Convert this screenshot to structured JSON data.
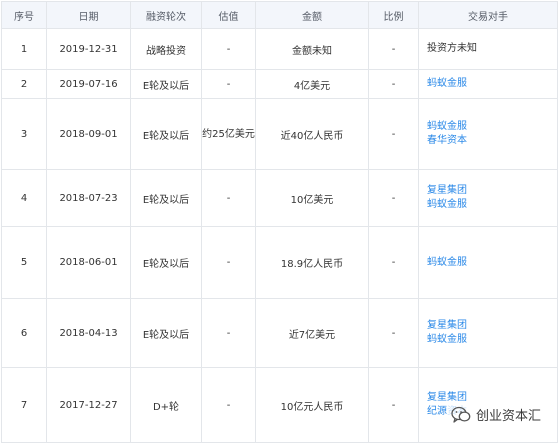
{
  "table": {
    "headers": [
      "序号",
      "日期",
      "融资轮次",
      "估值",
      "金额",
      "比例",
      "交易对手"
    ],
    "rows": [
      {
        "no": "1",
        "date": "2019-12-31",
        "round": "战略投资",
        "valuation": "-",
        "amount": "金额未知",
        "ratio": "-",
        "partners": [
          "投资方未知"
        ],
        "partners_linked": false
      },
      {
        "no": "2",
        "date": "2019-07-16",
        "round": "E轮及以后",
        "valuation": "-",
        "amount": "4亿美元",
        "ratio": "-",
        "partners": [
          "蚂蚁金服"
        ],
        "partners_linked": true
      },
      {
        "no": "3",
        "date": "2018-09-01",
        "round": "E轮及以后",
        "valuation": "约25亿美元",
        "amount": "近40亿人民币",
        "ratio": "-",
        "partners": [
          "蚂蚁金服",
          "春华资本"
        ],
        "partners_linked": true
      },
      {
        "no": "4",
        "date": "2018-07-23",
        "round": "E轮及以后",
        "valuation": "-",
        "amount": "10亿美元",
        "ratio": "-",
        "partners": [
          "复星集团",
          "蚂蚁金服"
        ],
        "partners_linked": true
      },
      {
        "no": "5",
        "date": "2018-06-01",
        "round": "E轮及以后",
        "valuation": "-",
        "amount": "18.9亿人民币",
        "ratio": "-",
        "partners": [
          "蚂蚁金服"
        ],
        "partners_linked": true
      },
      {
        "no": "6",
        "date": "2018-04-13",
        "round": "E轮及以后",
        "valuation": "-",
        "amount": "近7亿美元",
        "ratio": "-",
        "partners": [
          "复星集团",
          "蚂蚁金服"
        ],
        "partners_linked": true
      },
      {
        "no": "7",
        "date": "2017-12-27",
        "round": "D+轮",
        "valuation": "-",
        "amount": "10亿元人民币",
        "ratio": "-",
        "partners": [
          "复星集团",
          "纪源资本"
        ],
        "partners_linked": true
      }
    ]
  },
  "watermark": {
    "text": "创业资本汇",
    "icon": "wechat-icon"
  },
  "colors": {
    "header_bg": "#f3f6fb",
    "link": "#2c8ae8",
    "border": "#e3e6ea"
  }
}
